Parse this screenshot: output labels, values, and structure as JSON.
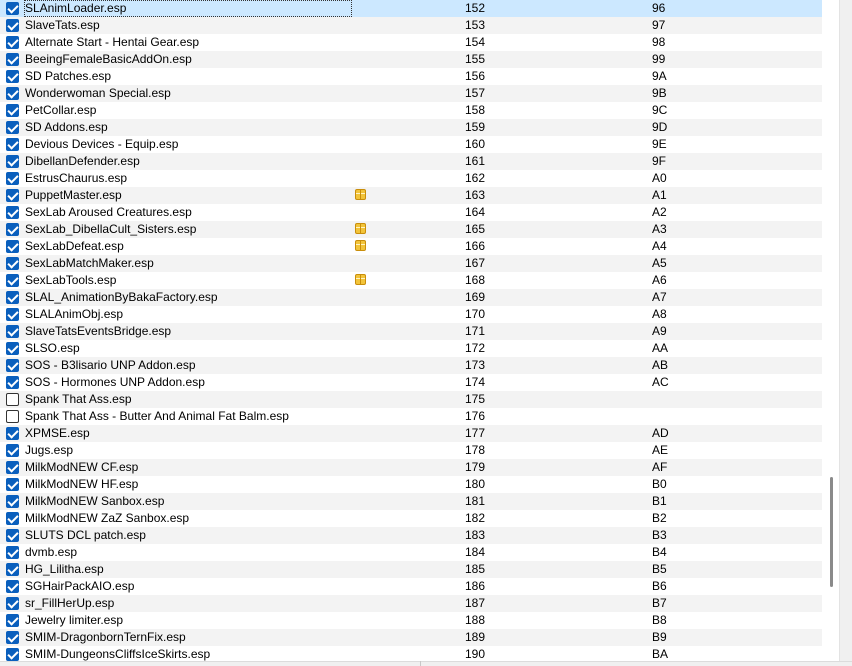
{
  "colors": {
    "selected_row": "#cce8ff",
    "alt_row": "#f3f3f3",
    "checkbox_checked": "#0a5fbd",
    "flag_icon": "#f2c43a"
  },
  "plugins": [
    {
      "name": "SLAnimLoader.esp",
      "priority": "152",
      "index": "96",
      "checked": true,
      "selected": true
    },
    {
      "name": "SlaveTats.esp",
      "priority": "153",
      "index": "97",
      "checked": true
    },
    {
      "name": "Alternate Start - Hentai Gear.esp",
      "priority": "154",
      "index": "98",
      "checked": true
    },
    {
      "name": "BeeingFemaleBasicAddOn.esp",
      "priority": "155",
      "index": "99",
      "checked": true
    },
    {
      "name": "SD Patches.esp",
      "priority": "156",
      "index": "9A",
      "checked": true
    },
    {
      "name": "Wonderwoman Special.esp",
      "priority": "157",
      "index": "9B",
      "checked": true
    },
    {
      "name": "PetCollar.esp",
      "priority": "158",
      "index": "9C",
      "checked": true
    },
    {
      "name": "SD Addons.esp",
      "priority": "159",
      "index": "9D",
      "checked": true
    },
    {
      "name": "Devious Devices - Equip.esp",
      "priority": "160",
      "index": "9E",
      "checked": true
    },
    {
      "name": "DibellanDefender.esp",
      "priority": "161",
      "index": "9F",
      "checked": true
    },
    {
      "name": "EstrusChaurus.esp",
      "priority": "162",
      "index": "A0",
      "checked": true
    },
    {
      "name": "PuppetMaster.esp",
      "priority": "163",
      "index": "A1",
      "checked": true,
      "flag": "package-icon"
    },
    {
      "name": "SexLab Aroused Creatures.esp",
      "priority": "164",
      "index": "A2",
      "checked": true
    },
    {
      "name": "SexLab_DibellaCult_Sisters.esp",
      "priority": "165",
      "index": "A3",
      "checked": true,
      "flag": "package-icon"
    },
    {
      "name": "SexLabDefeat.esp",
      "priority": "166",
      "index": "A4",
      "checked": true,
      "flag": "package-icon"
    },
    {
      "name": "SexLabMatchMaker.esp",
      "priority": "167",
      "index": "A5",
      "checked": true
    },
    {
      "name": "SexLabTools.esp",
      "priority": "168",
      "index": "A6",
      "checked": true,
      "flag": "package-icon"
    },
    {
      "name": "SLAL_AnimationByBakaFactory.esp",
      "priority": "169",
      "index": "A7",
      "checked": true
    },
    {
      "name": "SLALAnimObj.esp",
      "priority": "170",
      "index": "A8",
      "checked": true
    },
    {
      "name": "SlaveTatsEventsBridge.esp",
      "priority": "171",
      "index": "A9",
      "checked": true
    },
    {
      "name": "SLSO.esp",
      "priority": "172",
      "index": "AA",
      "checked": true
    },
    {
      "name": "SOS - B3lisario UNP Addon.esp",
      "priority": "173",
      "index": "AB",
      "checked": true
    },
    {
      "name": "SOS - Hormones UNP Addon.esp",
      "priority": "174",
      "index": "AC",
      "checked": true
    },
    {
      "name": "Spank That Ass.esp",
      "priority": "175",
      "index": "",
      "checked": false
    },
    {
      "name": "Spank That Ass - Butter And Animal Fat Balm.esp",
      "priority": "176",
      "index": "",
      "checked": false
    },
    {
      "name": "XPMSE.esp",
      "priority": "177",
      "index": "AD",
      "checked": true
    },
    {
      "name": "Jugs.esp",
      "priority": "178",
      "index": "AE",
      "checked": true
    },
    {
      "name": "MilkModNEW CF.esp",
      "priority": "179",
      "index": "AF",
      "checked": true
    },
    {
      "name": "MilkModNEW HF.esp",
      "priority": "180",
      "index": "B0",
      "checked": true
    },
    {
      "name": "MilkModNEW Sanbox.esp",
      "priority": "181",
      "index": "B1",
      "checked": true
    },
    {
      "name": "MilkModNEW ZaZ Sanbox.esp",
      "priority": "182",
      "index": "B2",
      "checked": true
    },
    {
      "name": "SLUTS DCL patch.esp",
      "priority": "183",
      "index": "B3",
      "checked": true
    },
    {
      "name": "dvmb.esp",
      "priority": "184",
      "index": "B4",
      "checked": true
    },
    {
      "name": "HG_Lilitha.esp",
      "priority": "185",
      "index": "B5",
      "checked": true
    },
    {
      "name": "SGHairPackAIO.esp",
      "priority": "186",
      "index": "B6",
      "checked": true
    },
    {
      "name": "sr_FillHerUp.esp",
      "priority": "187",
      "index": "B7",
      "checked": true
    },
    {
      "name": "Jewelry limiter.esp",
      "priority": "188",
      "index": "B8",
      "checked": true
    },
    {
      "name": "SMIM-DragonbornTernFix.esp",
      "priority": "189",
      "index": "B9",
      "checked": true
    },
    {
      "name": "SMIM-DungeonsCliffsIceSkirts.esp",
      "priority": "190",
      "index": "BA",
      "checked": true
    }
  ]
}
